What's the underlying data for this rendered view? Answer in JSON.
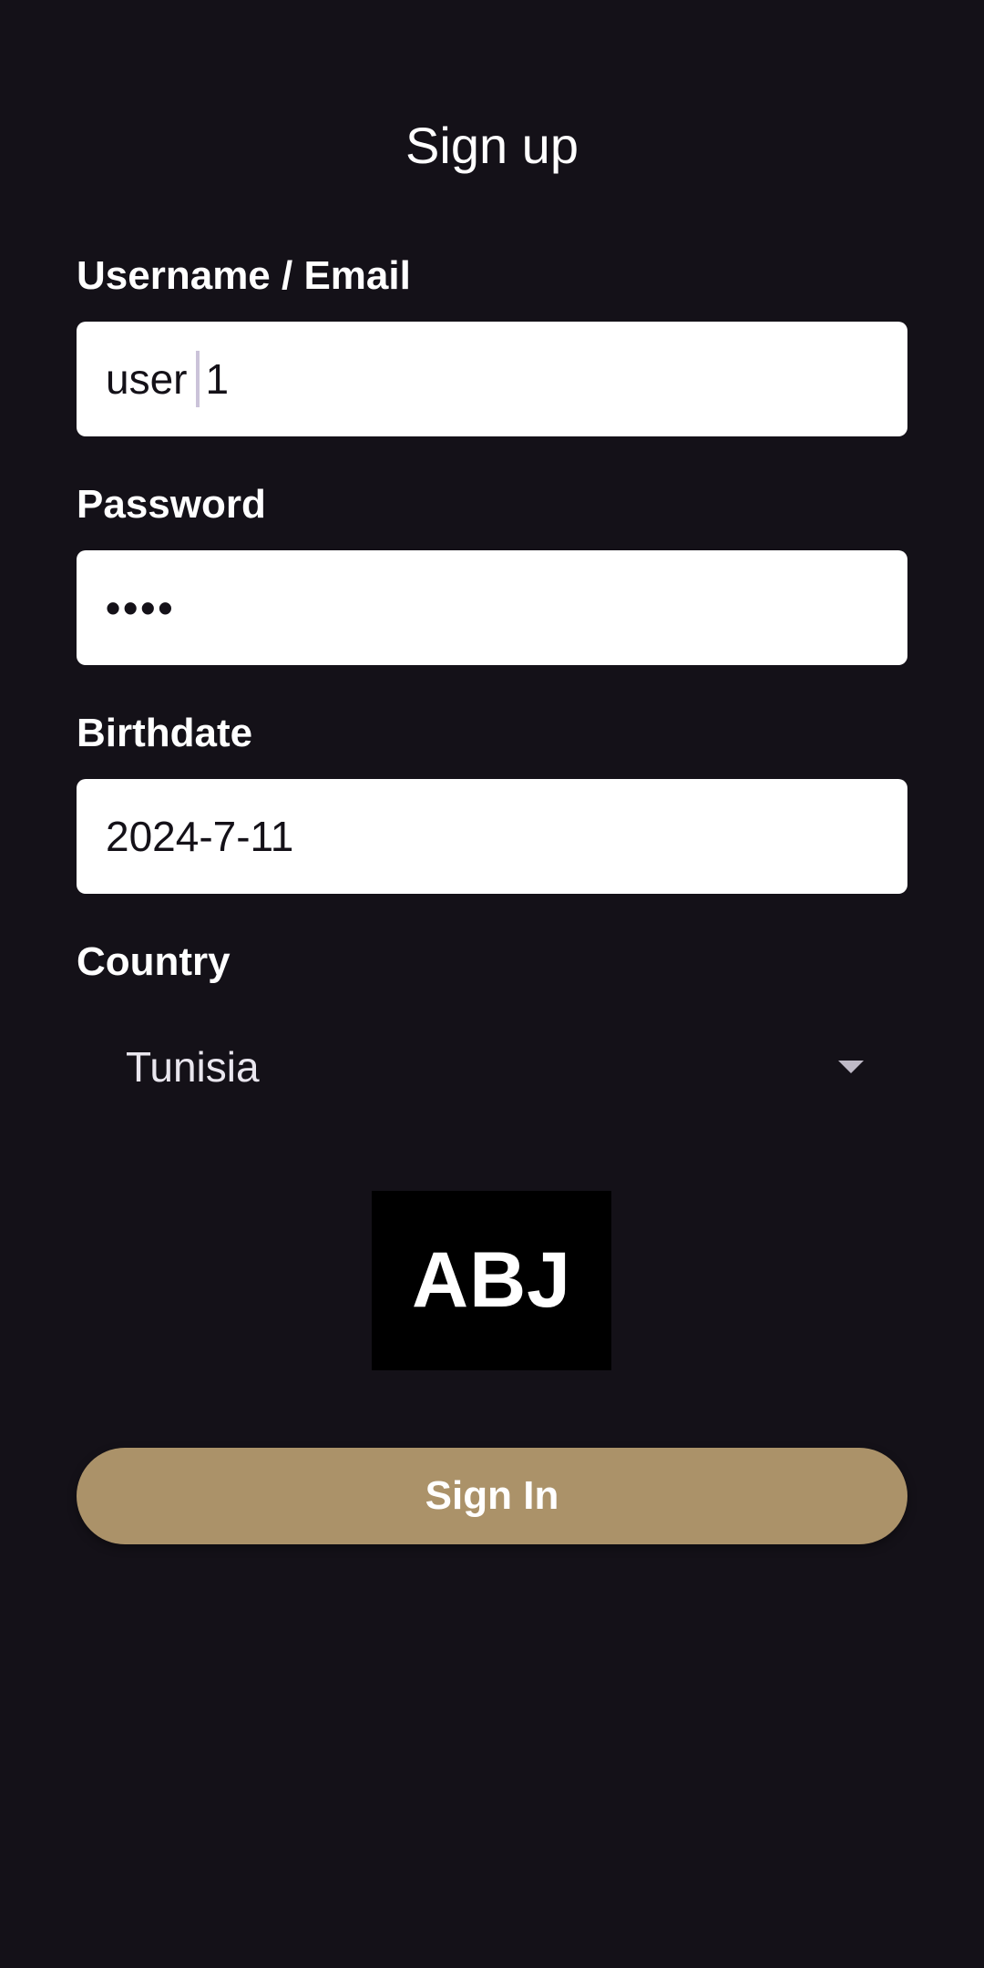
{
  "page": {
    "title": "Sign up"
  },
  "form": {
    "username_label": "Username / Email",
    "username_value_start": "user",
    "username_value_end": "1",
    "password_label": "Password",
    "password_value": "••••",
    "birthdate_label": "Birthdate",
    "birthdate_value": "2024-7-11",
    "country_label": "Country",
    "country_value": "Tunisia"
  },
  "logo": {
    "text": "ABJ"
  },
  "actions": {
    "sign_in_label": "Sign In"
  },
  "colors": {
    "background": "#141118",
    "field_bg": "#ffffff",
    "button_bg": "#ab9269",
    "logo_bg": "#000000"
  },
  "icons": {
    "dropdown_arrow": "chevron-down-icon"
  }
}
